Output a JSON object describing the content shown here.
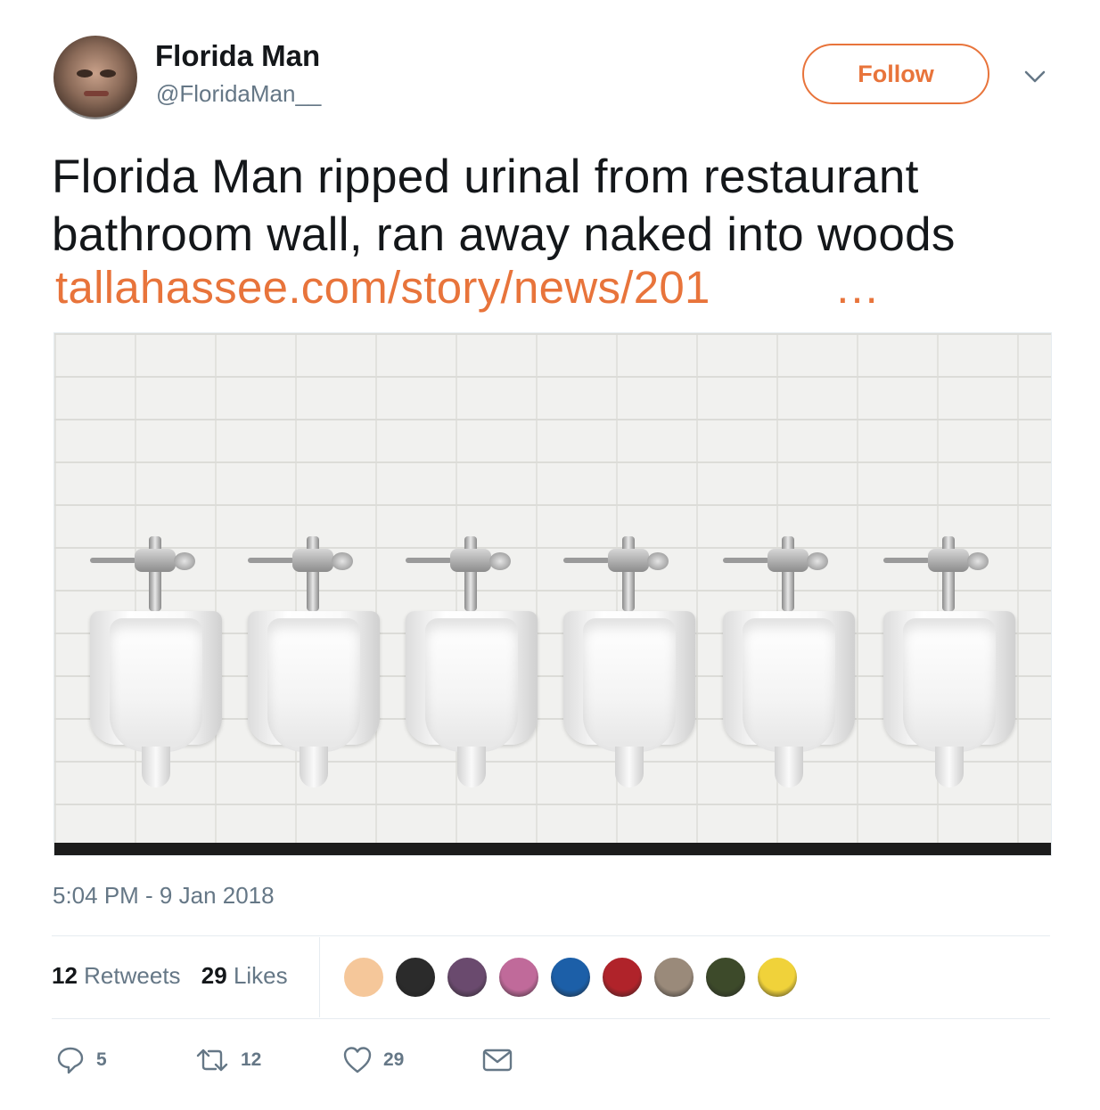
{
  "author": {
    "display_name": "Florida Man",
    "handle": "@FloridaMan__"
  },
  "header": {
    "follow_label": "Follow",
    "menu_icon": "chevron-down-icon"
  },
  "tweet": {
    "text": "Florida Man ripped urinal from restaurant bathroom wall, ran away naked into woods",
    "link": "tallahassee.com/story/news/201",
    "link_ellipsis": "…",
    "media_description_icon": "photo-of-six-urinals",
    "timestamp": "5:04 PM - 9 Jan 2018"
  },
  "stats": {
    "retweets_count": "12",
    "retweets_label": "Retweets",
    "likes_count": "29",
    "likes_label": "Likes"
  },
  "likers": [
    {
      "color": "#f5c79a"
    },
    {
      "color": "#2b2b2b"
    },
    {
      "color": "#6a4a6e"
    },
    {
      "color": "#c06a9a"
    },
    {
      "color": "#1c5fa8"
    },
    {
      "color": "#b0232a"
    },
    {
      "color": "#9a8a7a"
    },
    {
      "color": "#3d4a2a"
    },
    {
      "color": "#f0d23a"
    }
  ],
  "actions": {
    "reply_count": "5",
    "retweet_count": "12",
    "like_count": "29"
  },
  "colors": {
    "accent": "#e8743b",
    "secondary_text": "#657786",
    "primary_text": "#14171a",
    "divider": "#e6ecf0"
  }
}
